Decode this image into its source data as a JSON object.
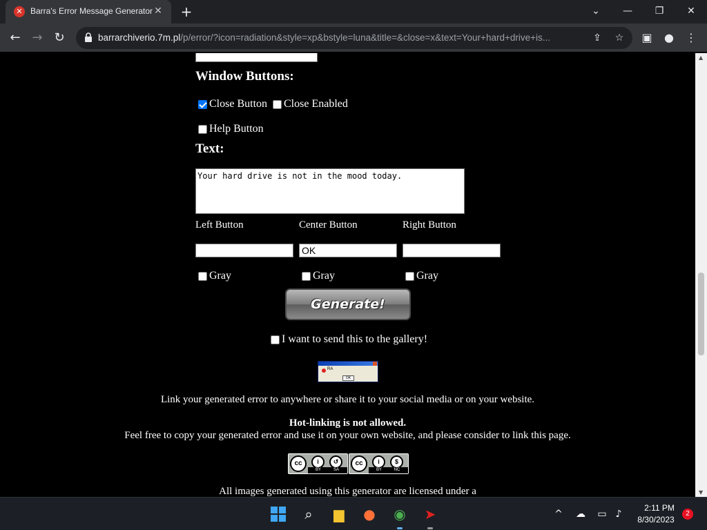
{
  "browser": {
    "tab_title": "Barra's Error Message Generator",
    "url_host": "barrarchiverio.7m.pl",
    "url_path": "/p/error/?icon=radiation&style=xp&bstyle=luna&title=&close=x&text=Your+hard+drive+is..."
  },
  "form": {
    "window_buttons_heading": "Window Buttons:",
    "close_button_label": "Close Button",
    "close_button_checked": true,
    "close_enabled_label": "Close Enabled",
    "help_button_label": "Help Button",
    "text_heading": "Text:",
    "text_value": "Your hard drive is not in the mood today.",
    "left_button_label": "Left Button",
    "center_button_label": "Center Button",
    "right_button_label": "Right Button",
    "left_button_value": "",
    "center_button_value": "OK",
    "right_button_value": "",
    "gray_label": "Gray",
    "generate_label": "Generate!",
    "gallery_label": "I want to send this to the gallery!"
  },
  "preview": {
    "text": "RA",
    "ok": "OK"
  },
  "info": {
    "link_text": "Link your generated error to anywhere or share it to your social media or on your website.",
    "hotlink_text": "Hot-linking is not allowed.",
    "copy_text": "Feel free to copy your generated error and use it on your own website, and please consider to link this page.",
    "license_text": "All images generated using this generator are licensed under a",
    "cc1": {
      "logo": "cc",
      "by": "BY",
      "sa": "SA"
    },
    "cc2": {
      "logo": "cc",
      "by": "BY",
      "nc": "NC"
    }
  },
  "taskbar": {
    "time": "2:11 PM",
    "date": "8/30/2023",
    "notification_count": "2"
  }
}
